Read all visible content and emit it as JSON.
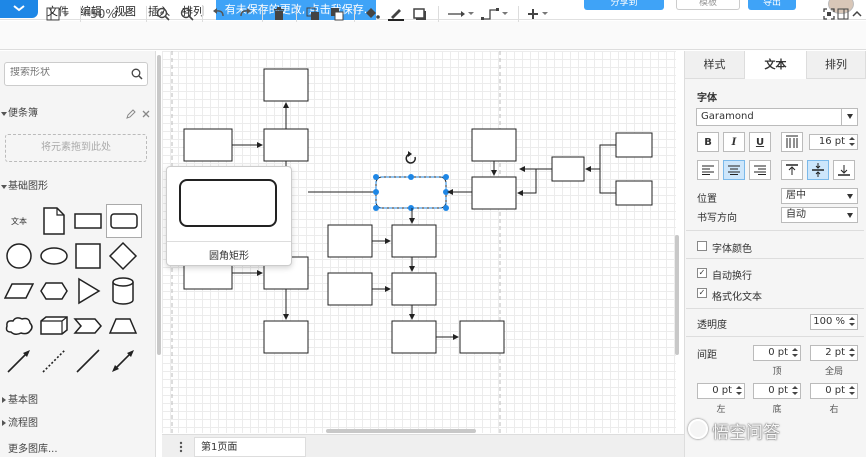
{
  "menu": {
    "file": "文件",
    "edit": "编辑",
    "view": "视图",
    "insert": "插入",
    "arrange": "排列",
    "unsaved_notice": "有未保存的更改, 点击我保存.",
    "share": "分享到",
    "template": "模板",
    "export": "导出"
  },
  "toolbar": {
    "zoom": "50%"
  },
  "sidebar": {
    "search_placeholder": "搜索形状",
    "scratchpad": "便条簿",
    "dropzone": "将元素拖到此处",
    "basic_shapes": "基础图形",
    "text_shape": "文本",
    "basic_diagram": "基本图",
    "flowchart": "流程图",
    "more_libs": "更多图库..."
  },
  "tooltip": {
    "label": "圆角矩形"
  },
  "bottom": {
    "page_tab": "第1页面"
  },
  "right_panel": {
    "tabs": [
      "样式",
      "文本",
      "排列"
    ],
    "font_label": "字体",
    "font_value": "Garamond",
    "bold": "B",
    "italic": "I",
    "underline": "U",
    "font_size": "16 pt",
    "position_label": "位置",
    "position_value": "居中",
    "writing_dir_label": "书写方向",
    "writing_dir_value": "自动",
    "font_color_label": "字体颜色",
    "auto_wrap_label": "自动换行",
    "formatted_text_label": "格式化文本",
    "opacity_label": "透明度",
    "opacity_value": "100 %",
    "spacing_label": "间距",
    "spacing_top": "0 pt",
    "spacing_global": "2 pt",
    "spacing_left": "0 pt",
    "spacing_bottom": "0 pt",
    "spacing_right": "0 pt",
    "sub_top": "顶",
    "sub_global": "全局",
    "sub_left": "左",
    "sub_bottom": "底",
    "sub_right": "右"
  },
  "watermark": "悟空问答",
  "colors": {
    "accent": "#3fa3f7",
    "selection": "#1e87e6"
  }
}
